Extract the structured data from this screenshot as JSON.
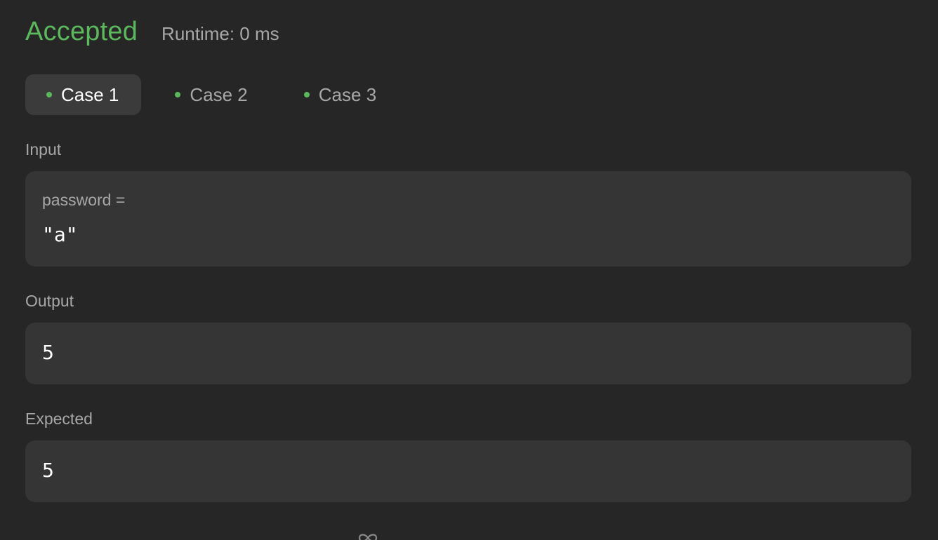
{
  "result": {
    "status": "Accepted",
    "runtime": "Runtime: 0 ms",
    "status_color": "#5cb85c"
  },
  "tabs": [
    {
      "label": "Case 1",
      "active": true,
      "passed": true
    },
    {
      "label": "Case 2",
      "active": false,
      "passed": true
    },
    {
      "label": "Case 3",
      "active": false,
      "passed": true
    }
  ],
  "input": {
    "section_label": "Input",
    "variable_label": "password =",
    "value": "\"a\""
  },
  "output": {
    "section_label": "Output",
    "value": "5"
  },
  "expected": {
    "section_label": "Expected",
    "value": "5"
  },
  "icons": {
    "bottom": "infinity-icon"
  }
}
